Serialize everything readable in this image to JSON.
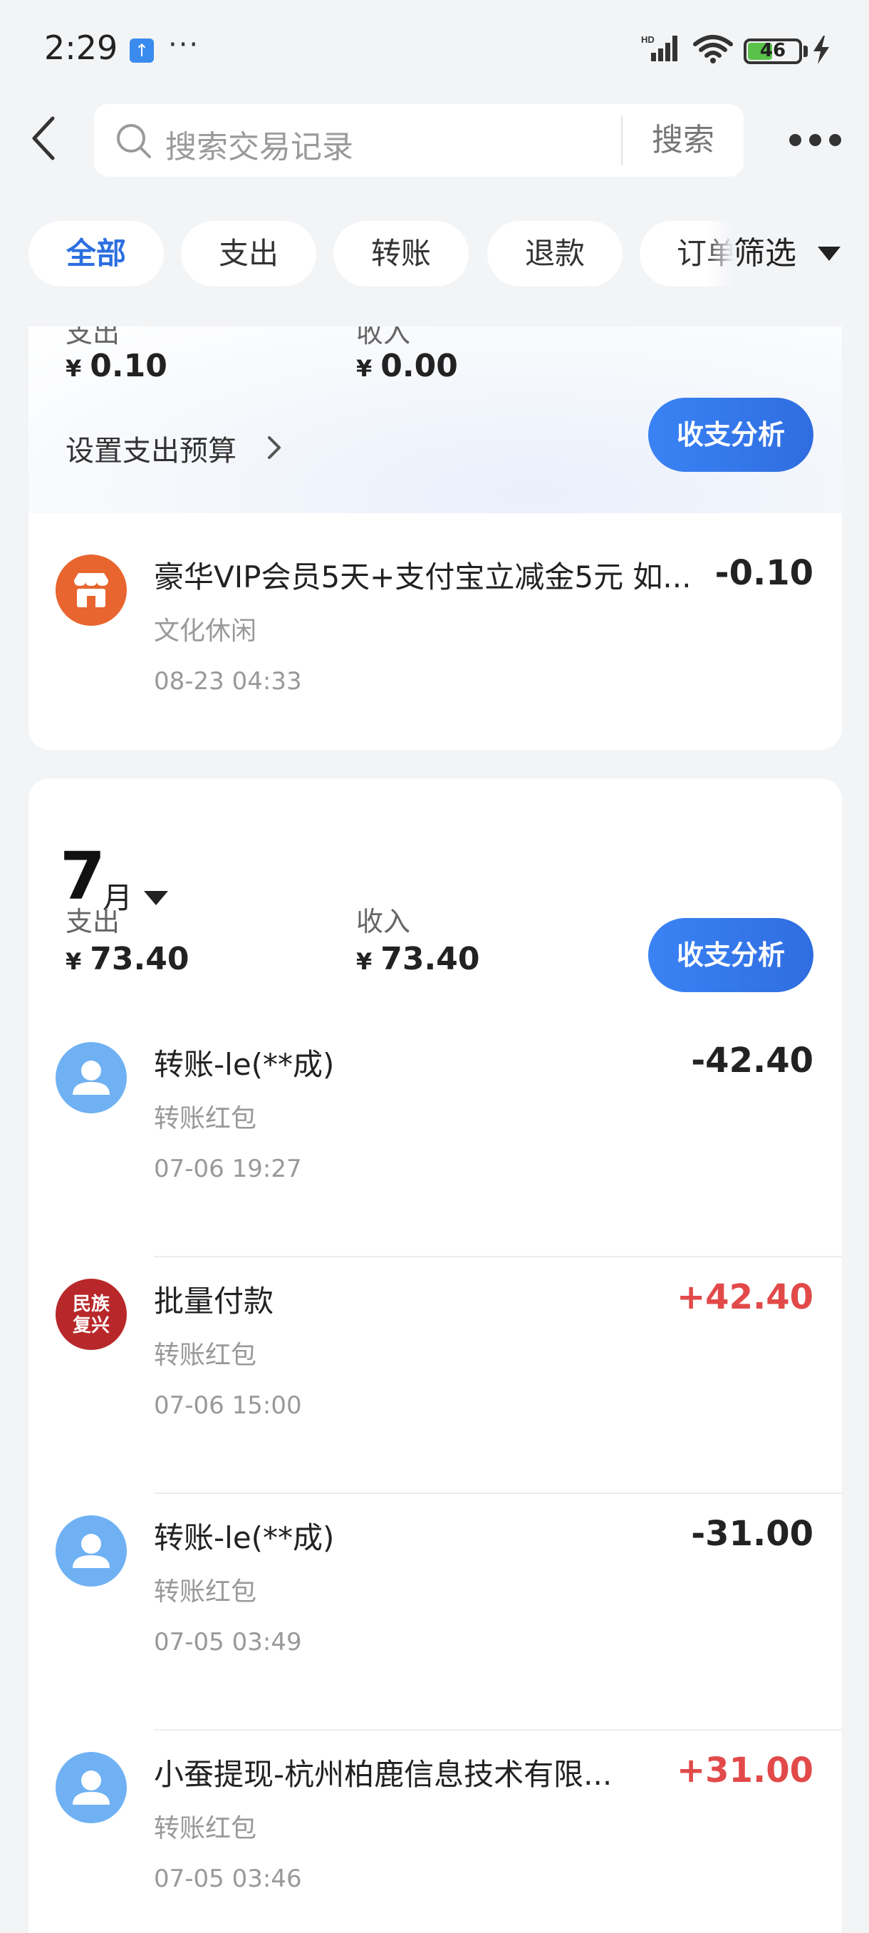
{
  "status_bar": {
    "time": "2:29",
    "more": "···",
    "battery_level": "46",
    "battery_fraction": 0.46
  },
  "header": {
    "search_placeholder": "搜索交易记录",
    "search_button": "搜索"
  },
  "filter_tabs": {
    "items": [
      "全部",
      "支出",
      "转账",
      "退款"
    ],
    "partial_item": "订单",
    "filter_label": "筛选",
    "active_color": "#2d6fe0"
  },
  "august": {
    "expense_label": "支出",
    "income_label": "收入",
    "currency": "¥",
    "expense": "0.10",
    "income": "0.00",
    "budget_link": "设置支出预算",
    "analysis_button": "收支分析",
    "transactions": [
      {
        "title": "豪华VIP会员5天+支付宝立减金5元 如...",
        "category": "文化休闲",
        "time": "08-23 04:33",
        "amount": "-0.10",
        "icon": "store-icon"
      }
    ]
  },
  "july": {
    "month_number": "7",
    "month_unit": "月",
    "expense_label": "支出",
    "income_label": "收入",
    "currency": "¥",
    "expense": "73.40",
    "income": "73.40",
    "analysis_button": "收支分析",
    "transactions": [
      {
        "title": "转账-le(**成)",
        "category": "转账红包",
        "time": "07-06 19:27",
        "amount": "-42.40",
        "icon": "user-avatar-icon"
      },
      {
        "title": "批量付款",
        "category": "转账红包",
        "time": "07-06 15:00",
        "amount": "+42.40",
        "icon": "seal-avatar",
        "seal_text": "民族复兴"
      },
      {
        "title": "转账-le(**成)",
        "category": "转账红包",
        "time": "07-05 03:49",
        "amount": "-31.00",
        "icon": "user-avatar-icon"
      },
      {
        "title": "小蚕提现-杭州柏鹿信息技术有限...",
        "category": "转账红包",
        "time": "07-05 03:46",
        "amount": "+31.00",
        "icon": "user-avatar-icon"
      }
    ]
  },
  "colors": {
    "income": "#e24a4a",
    "button": "#3a83f5",
    "avatar_user": "#6fb1f3",
    "avatar_store": "#e8652f",
    "avatar_seal": "#b8282a"
  }
}
